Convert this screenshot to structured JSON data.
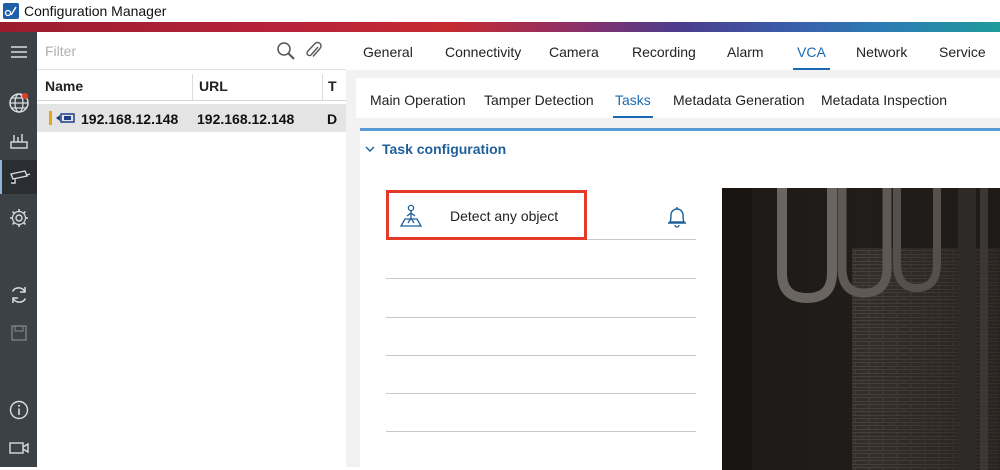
{
  "app": {
    "title": "Configuration Manager",
    "accent_color": "#1a6ab3",
    "stripe_colors": [
      "#9b1c2e",
      "#c52a30",
      "#4a3c8c",
      "#2c7ab5",
      "#1f9b9b"
    ]
  },
  "sidebar": {
    "items": [
      {
        "name": "menu-icon"
      },
      {
        "name": "network-globe-icon"
      },
      {
        "name": "devices-icon"
      },
      {
        "name": "camera-icon",
        "active": true
      },
      {
        "name": "settings-gear-icon"
      },
      {
        "name": "refresh-icon"
      },
      {
        "name": "save-icon"
      },
      {
        "name": "info-icon"
      },
      {
        "name": "video-icon"
      }
    ]
  },
  "device_panel": {
    "filter_placeholder": "Filter",
    "columns": [
      "Name",
      "URL",
      "T"
    ],
    "rows": [
      {
        "name": "192.168.12.148",
        "url": "192.168.12.148",
        "type": "D"
      }
    ]
  },
  "main_tabs": [
    "General",
    "Connectivity",
    "Camera",
    "Recording",
    "Alarm",
    "VCA",
    "Network",
    "Service"
  ],
  "main_tabs_active": "VCA",
  "sub_tabs": [
    "Main Operation",
    "Tamper Detection",
    "Tasks",
    "Metadata Generation",
    "Metadata Inspection"
  ],
  "sub_tabs_active": "Tasks",
  "task_config": {
    "title": "Task configuration",
    "tasks": [
      {
        "label": "Detect any object",
        "icon": "person-detect-icon",
        "alarm_icon": "bell-icon"
      }
    ],
    "highlight_color": "#e53a2a"
  }
}
